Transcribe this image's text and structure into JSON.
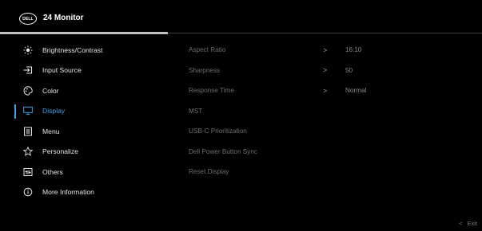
{
  "header": {
    "brand": "DELL",
    "title": "24 Monitor"
  },
  "menu": [
    {
      "label": "Brightness/Contrast",
      "icon": "brightness-icon"
    },
    {
      "label": "Input Source",
      "icon": "input-source-icon"
    },
    {
      "label": "Color",
      "icon": "palette-icon"
    },
    {
      "label": "Display",
      "icon": "display-icon",
      "active": true
    },
    {
      "label": "Menu",
      "icon": "menu-icon"
    },
    {
      "label": "Personalize",
      "icon": "star-icon"
    },
    {
      "label": "Others",
      "icon": "others-icon"
    },
    {
      "label": "More Information",
      "icon": "info-icon"
    }
  ],
  "submenu": [
    {
      "label": "Aspect Ratio",
      "chevron": ">",
      "value": "16:10"
    },
    {
      "label": "Sharpness",
      "chevron": ">",
      "value": "50"
    },
    {
      "label": "Response Time",
      "chevron": ">",
      "value": "Normal"
    },
    {
      "label": "MST",
      "chevron": "",
      "value": ""
    },
    {
      "label": "USB-C Prioritization",
      "chevron": "",
      "value": ""
    },
    {
      "label": "Dell Power Button Sync",
      "chevron": "",
      "value": ""
    },
    {
      "label": "Reset Display",
      "chevron": "",
      "value": ""
    }
  ],
  "footer": {
    "exit_chevron": "<",
    "exit_label": "Exit"
  },
  "colors": {
    "accent": "#3d9fe6",
    "background": "#000000"
  }
}
